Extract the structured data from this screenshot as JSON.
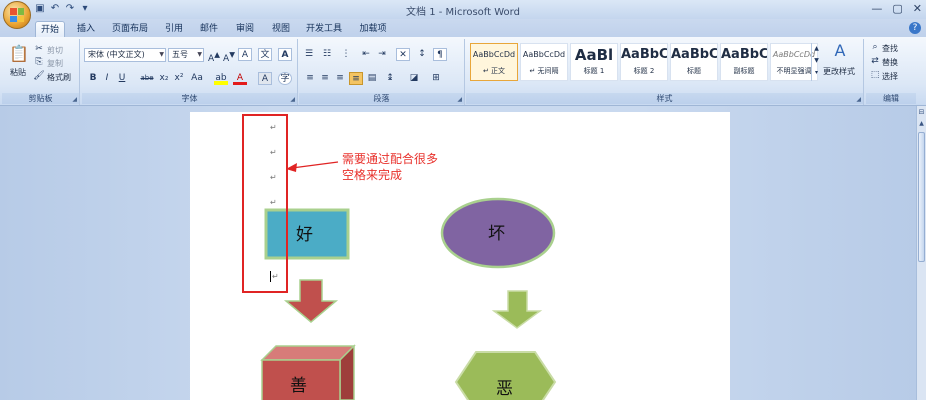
{
  "window": {
    "title": "文档 1 - Microsoft Word",
    "controls": [
      "—",
      "▢",
      "✕"
    ]
  },
  "quick_access": [
    "save-icon",
    "undo-icon",
    "redo-icon",
    "customize-icon"
  ],
  "tabs": [
    {
      "label": "开始",
      "active": true
    },
    {
      "label": "插入",
      "active": false
    },
    {
      "label": "页面布局",
      "active": false
    },
    {
      "label": "引用",
      "active": false
    },
    {
      "label": "邮件",
      "active": false
    },
    {
      "label": "审阅",
      "active": false
    },
    {
      "label": "视图",
      "active": false
    },
    {
      "label": "开发工具",
      "active": false
    },
    {
      "label": "加载项",
      "active": false
    }
  ],
  "clipboard": {
    "paste": "粘贴",
    "cut": "剪切",
    "copy": "复制",
    "format_painter": "格式刷",
    "group_label": "剪贴板"
  },
  "font": {
    "font_name": "宋体 (中文正文)",
    "font_size": "五号",
    "group_label": "字体",
    "buttons": [
      "B",
      "I",
      "U",
      "abe",
      "x₂",
      "x²",
      "Aa"
    ]
  },
  "paragraph": {
    "group_label": "段落"
  },
  "styles": {
    "group_label": "样式",
    "items": [
      {
        "sample": "AaBbCcDd",
        "name": "↵ 正文",
        "selected": true
      },
      {
        "sample": "AaBbCcDd",
        "name": "↵ 无间隔",
        "selected": false
      },
      {
        "sample": "AaBl",
        "name": "标题 1",
        "selected": false
      },
      {
        "sample": "AaBbC",
        "name": "标题 2",
        "selected": false
      },
      {
        "sample": "AaBbC",
        "name": "标题",
        "selected": false
      },
      {
        "sample": "AaBbC",
        "name": "副标题",
        "selected": false
      },
      {
        "sample": "AaBbCcDd",
        "name": "不明显强调",
        "selected": false
      }
    ],
    "change_styles": "更改样式"
  },
  "editing": {
    "find": "查找",
    "replace": "替换",
    "select": "选择",
    "group_label": "编辑"
  },
  "document": {
    "shapes": {
      "rect_label": "好",
      "ellipse_label": "坏",
      "cube_label": "善",
      "hexagon_label": "恶"
    },
    "annotation_line1": "需要通过配合很多",
    "annotation_line2": "空格来完成",
    "para_mark": "↵"
  },
  "colors": {
    "rect_fill": "#4bacc6",
    "ellipse_fill": "#8064a2",
    "shape_border": "#a9d08e",
    "arrow_red": "#c0504d",
    "arrow_green": "#9bbb59",
    "cube_fill": "#c0504d",
    "hex_fill": "#9bbb59",
    "annotation": "#e8312c"
  }
}
